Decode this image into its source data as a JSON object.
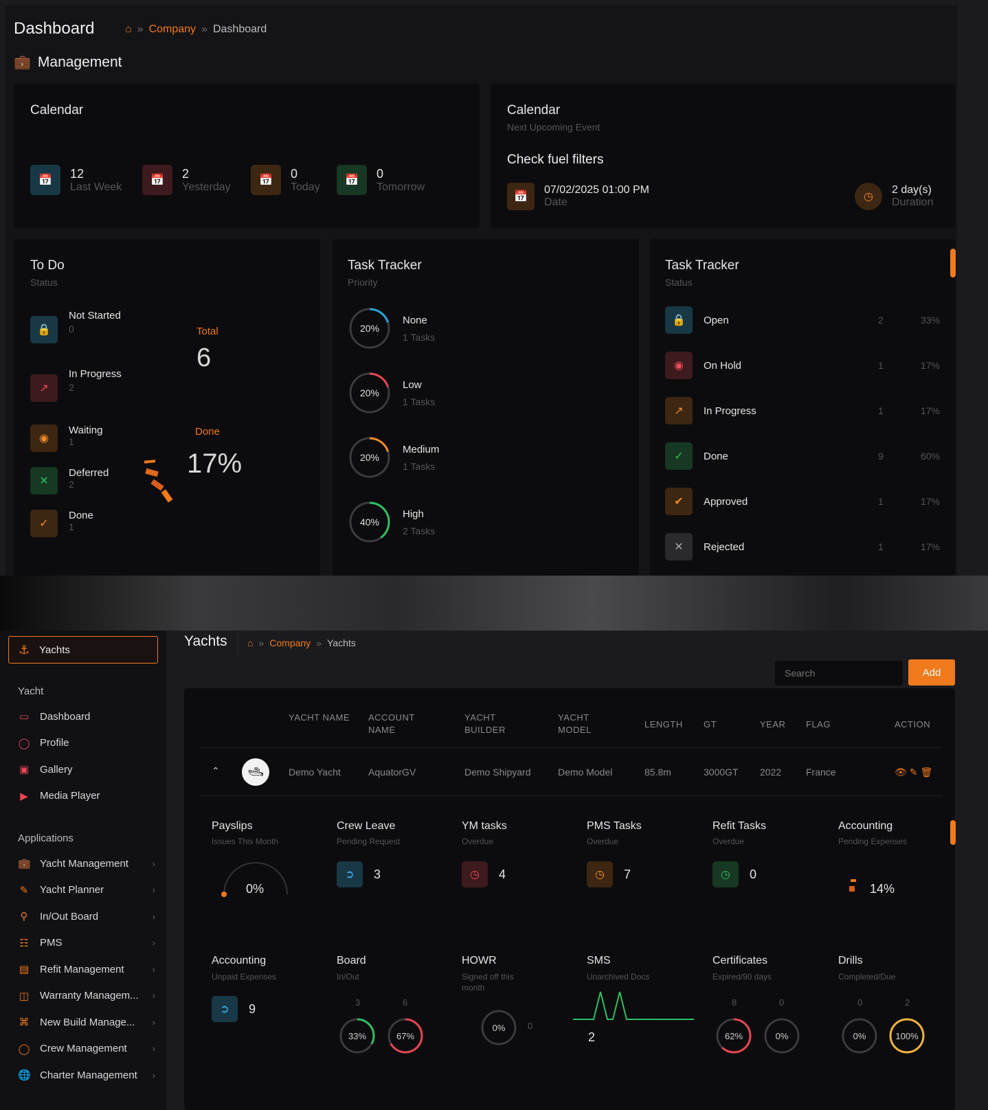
{
  "dashboard": {
    "page_title": "Dashboard",
    "breadcrumb": {
      "company": "Company",
      "current": "Dashboard"
    },
    "section_title": "Management",
    "calendar_left": {
      "title": "Calendar",
      "stats": [
        {
          "value": "12",
          "label": "Last Week"
        },
        {
          "value": "2",
          "label": "Yesterday"
        },
        {
          "value": "0",
          "label": "Today"
        },
        {
          "value": "0",
          "label": "Tomorrow"
        }
      ]
    },
    "calendar_right": {
      "title": "Calendar",
      "subtitle": "Next Upcoming Event",
      "event": "Check fuel filters",
      "date_value": "07/02/2025 01:00 PM",
      "date_label": "Date",
      "duration_value": "2 day(s)",
      "duration_label": "Duration"
    },
    "todo": {
      "title": "To Do",
      "subtitle": "Status",
      "items": [
        {
          "label": "Not Started",
          "count": "0"
        },
        {
          "label": "In Progress",
          "count": "2"
        },
        {
          "label": "Waiting",
          "count": "1"
        },
        {
          "label": "Deferred",
          "count": "2"
        },
        {
          "label": "Done",
          "count": "1"
        }
      ],
      "total_label": "Total",
      "total_value": "6",
      "done_label": "Done",
      "done_value": "17%"
    },
    "task_priority": {
      "title": "Task Tracker",
      "subtitle": "Priority",
      "items": [
        {
          "pct": "20%",
          "label": "None",
          "tasks": "1 Tasks",
          "fraction": 0.2,
          "color": "#2aa3d8"
        },
        {
          "pct": "20%",
          "label": "Low",
          "tasks": "1 Tasks",
          "fraction": 0.2,
          "color": "#e64553"
        },
        {
          "pct": "20%",
          "label": "Medium",
          "tasks": "1 Tasks",
          "fraction": 0.2,
          "color": "#f08a2a"
        },
        {
          "pct": "40%",
          "label": "High",
          "tasks": "2 Tasks",
          "fraction": 0.4,
          "color": "#2fbf62"
        }
      ]
    },
    "task_status": {
      "title": "Task Tracker",
      "subtitle": "Status",
      "items": [
        {
          "label": "Open",
          "count": "2",
          "pct": "33%"
        },
        {
          "label": "On Hold",
          "count": "1",
          "pct": "17%"
        },
        {
          "label": "In Progress",
          "count": "1",
          "pct": "17%"
        },
        {
          "label": "Done",
          "count": "9",
          "pct": "60%"
        },
        {
          "label": "Approved",
          "count": "1",
          "pct": "17%"
        },
        {
          "label": "Rejected",
          "count": "1",
          "pct": "17%"
        }
      ]
    }
  },
  "yachts": {
    "page_title": "Yachts",
    "breadcrumb": {
      "company": "Company",
      "current": "Yachts"
    },
    "search_placeholder": "Search",
    "add_label": "Add",
    "sidebar": {
      "active": "Yachts",
      "yacht_heading": "Yacht",
      "yacht_items": [
        "Dashboard",
        "Profile",
        "Gallery",
        "Media Player"
      ],
      "apps_heading": "Applications",
      "app_items": [
        "Yacht Management",
        "Yacht Planner",
        "In/Out Board",
        "PMS",
        "Refit Management",
        "Warranty Managem...",
        "New Build Manage...",
        "Crew Management",
        "Charter Management"
      ]
    },
    "table": {
      "headers": [
        "YACHT NAME",
        "ACCOUNT NAME",
        "YACHT BUILDER",
        "YACHT MODEL",
        "LENGTH",
        "GT",
        "YEAR",
        "FLAG",
        "ACTION"
      ],
      "row": [
        "Demo Yacht",
        "AquatorGV",
        "Demo Shipyard",
        "Demo Model",
        "85.8m",
        "3000GT",
        "2022",
        "France"
      ]
    },
    "widgets_row1": [
      {
        "title": "Payslips",
        "subtitle": "Issues This Month",
        "value": "0%"
      },
      {
        "title": "Crew Leave",
        "subtitle": "Pending Request",
        "value": "3"
      },
      {
        "title": "YM tasks",
        "subtitle": "Overdue",
        "value": "4"
      },
      {
        "title": "PMS Tasks",
        "subtitle": "Overdue",
        "value": "7"
      },
      {
        "title": "Refit Tasks",
        "subtitle": "Overdue",
        "value": "0"
      },
      {
        "title": "Accounting",
        "subtitle": "Pending Expenses",
        "value": "14%"
      }
    ],
    "widgets_row2": [
      {
        "title": "Accounting",
        "subtitle": "Unpaid Expenses",
        "value": "9"
      },
      {
        "title": "Board",
        "subtitle": "In/Out",
        "a_count": "3",
        "b_count": "6",
        "a_pct": "33%",
        "b_pct": "67%"
      },
      {
        "title": "HOWR",
        "subtitle": "Signed off this month",
        "pct": "0%",
        "count": "0"
      },
      {
        "title": "SMS",
        "subtitle": "Unarchived Docs",
        "value": "2"
      },
      {
        "title": "Certificates",
        "subtitle": "Expired/90 days",
        "a_count": "8",
        "b_count": "0",
        "a_pct": "62%",
        "b_pct": "0%"
      },
      {
        "title": "Drills",
        "subtitle": "Completed/Due",
        "a_count": "0",
        "b_count": "2",
        "a_pct": "0%",
        "b_pct": "100%"
      }
    ]
  }
}
